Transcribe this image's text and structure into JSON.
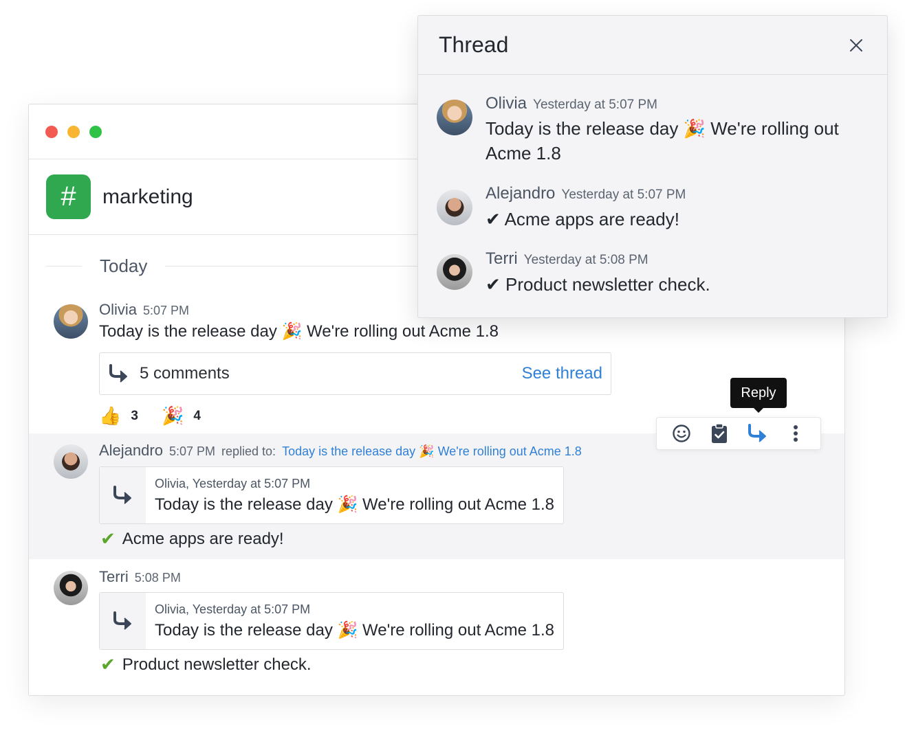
{
  "window": {
    "colors": {
      "close": "#f25a52",
      "minimize": "#f7b531",
      "maximize": "#2fc247"
    }
  },
  "channel": {
    "icon": "#",
    "name": "marketing",
    "accent": "#2fa84f"
  },
  "day_divider": "Today",
  "messages": [
    {
      "author": "Olivia",
      "time": "5:07 PM",
      "text": "Today is the release day 🎉 We're rolling out Acme 1.8",
      "comments_count": "5 comments",
      "see_thread": "See thread",
      "reactions": [
        {
          "emoji": "👍",
          "count": "3"
        },
        {
          "emoji": "🎉",
          "count": "4"
        }
      ]
    },
    {
      "author": "Alejandro",
      "time": "5:07 PM",
      "replied_to_label": "replied to:",
      "replied_to_text": "Today is the release day 🎉 We're rolling out Acme 1.8",
      "quote_meta": "Olivia, Yesterday at 5:07 PM",
      "quote_text": "Today is the release day 🎉 We're rolling out Acme 1.8",
      "check": "✔",
      "text": "Acme apps are ready!"
    },
    {
      "author": "Terri",
      "time": "5:08 PM",
      "quote_meta": "Olivia, Yesterday at 5:07 PM",
      "quote_text": "Today is the release day 🎉 We're rolling out Acme 1.8",
      "check": "✔",
      "text": "Product newsletter check."
    }
  ],
  "actions": {
    "tooltip": "Reply",
    "icons": [
      "emoji-icon",
      "clipboard-check-icon",
      "reply-icon",
      "more-vertical-icon"
    ]
  },
  "thread": {
    "title": "Thread",
    "messages": [
      {
        "author": "Olivia",
        "time": "Yesterday at 5:07 PM",
        "text": "Today is the release day 🎉 We're rolling out Acme 1.8"
      },
      {
        "author": "Alejandro",
        "time": "Yesterday at 5:07 PM",
        "text": "✔ Acme apps are ready!"
      },
      {
        "author": "Terri",
        "time": "Yesterday at 5:08 PM",
        "text": "✔ Product newsletter check."
      }
    ]
  }
}
